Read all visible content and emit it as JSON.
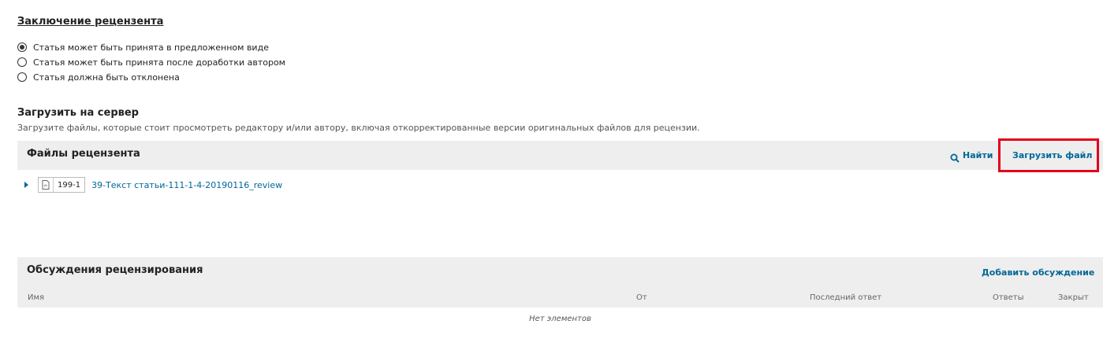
{
  "conclusion": {
    "title": "Заключение рецензента",
    "options": [
      {
        "label": "Статья может быть принята в предложенном виде",
        "checked": true
      },
      {
        "label": "Статья может быть принята после доработки автором",
        "checked": false
      },
      {
        "label": "Статья должна быть отклонена",
        "checked": false
      }
    ]
  },
  "upload": {
    "title": "Загрузить на сервер",
    "description": "Загрузите файлы, которые стоит просмотреть редактору и/или автору, включая откорректированные версии оригинальных файлов для рецензии."
  },
  "files_panel": {
    "title": "Файлы рецензента",
    "search_label": "Найти",
    "upload_label": "Загрузить файл",
    "files": [
      {
        "id": "199-1",
        "name": "39-Текст статьи-111-1-4-20190116_review"
      }
    ]
  },
  "discussions_panel": {
    "title": "Обсуждения рецензирования",
    "add_label": "Добавить обсуждение",
    "columns": [
      "Имя",
      "От",
      "Последний ответ",
      "Ответы",
      "Закрыт"
    ],
    "empty_text": "Нет элементов"
  },
  "colors": {
    "link": "#006798",
    "highlight": "#e3001b",
    "panel_bg": "#eeeeee"
  }
}
